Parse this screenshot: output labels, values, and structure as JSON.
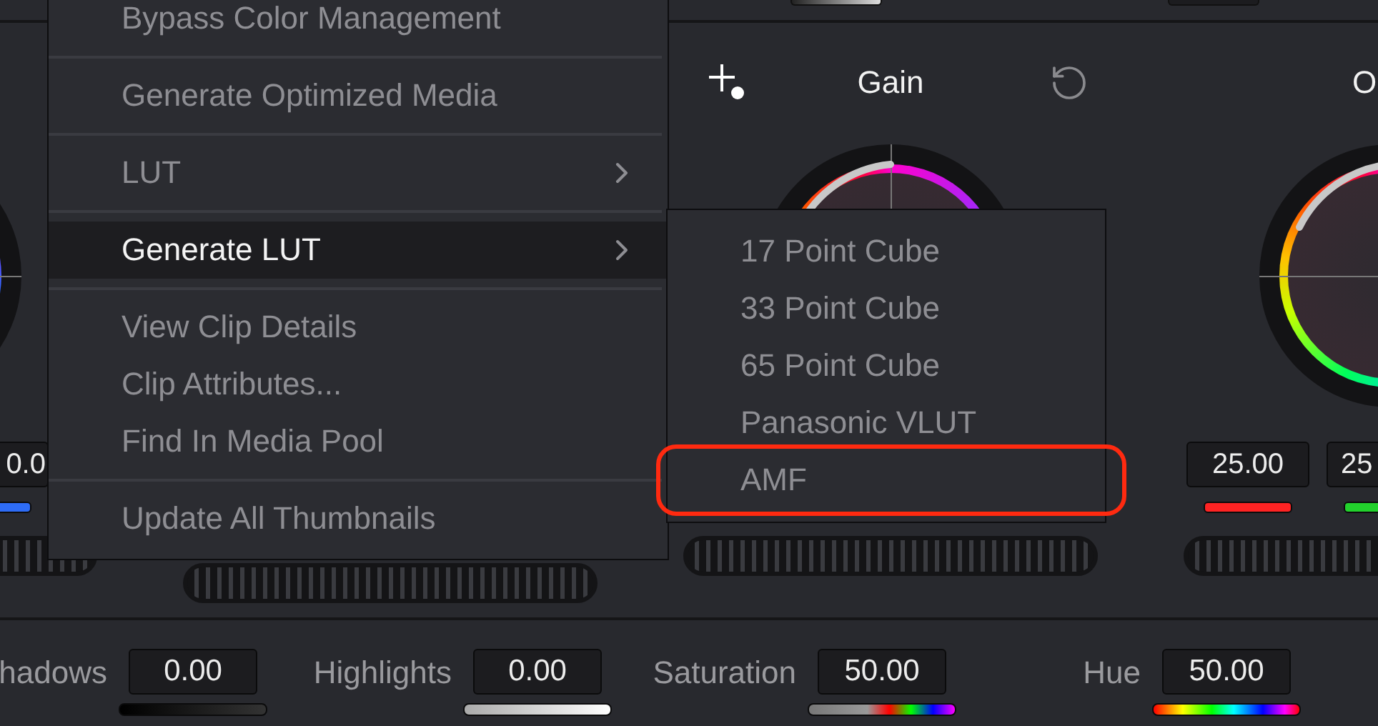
{
  "columns": [
    {
      "kind": "wheel",
      "values": [
        {
          "text": "0.0",
          "color": "#2e6cf6"
        }
      ]
    },
    {
      "kind": "jog"
    },
    {
      "kind": "wheel",
      "title": "Gain"
    },
    {
      "kind": "wheel",
      "title": "O",
      "values": [
        {
          "text": "25.00",
          "color": "#ff2323"
        },
        {
          "text": "25",
          "color": "#22d12c"
        }
      ]
    }
  ],
  "bottom_bar": [
    {
      "label": "hadows",
      "value": "0.00",
      "kind": "dark"
    },
    {
      "label": "Highlights",
      "value": "0.00",
      "kind": "light"
    },
    {
      "label": "Saturation",
      "value": "50.00",
      "kind": "saturation"
    },
    {
      "label": "Hue",
      "value": "50.00",
      "kind": "hue"
    }
  ],
  "context_menu": {
    "groups": [
      [
        {
          "label": "Bypass Color Management",
          "submenu": false,
          "selected": false
        }
      ],
      [
        {
          "label": "Generate Optimized Media",
          "submenu": false,
          "selected": false
        }
      ],
      [
        {
          "label": "LUT",
          "submenu": true,
          "selected": false
        }
      ],
      [
        {
          "label": "Generate LUT",
          "submenu": true,
          "selected": true
        }
      ],
      [
        {
          "label": "View Clip Details",
          "submenu": false,
          "selected": false
        },
        {
          "label": "Clip Attributes...",
          "submenu": false,
          "selected": false
        },
        {
          "label": "Find In Media Pool",
          "submenu": false,
          "selected": false
        }
      ],
      [
        {
          "label": "Update All Thumbnails",
          "submenu": false,
          "selected": false
        }
      ]
    ]
  },
  "submenu": {
    "items": [
      {
        "label": "17 Point Cube",
        "annotated": false
      },
      {
        "label": "33 Point Cube",
        "annotated": false
      },
      {
        "label": "65 Point Cube",
        "annotated": false
      },
      {
        "label": "Panasonic VLUT",
        "annotated": false
      },
      {
        "label": "AMF",
        "annotated": true
      }
    ]
  }
}
